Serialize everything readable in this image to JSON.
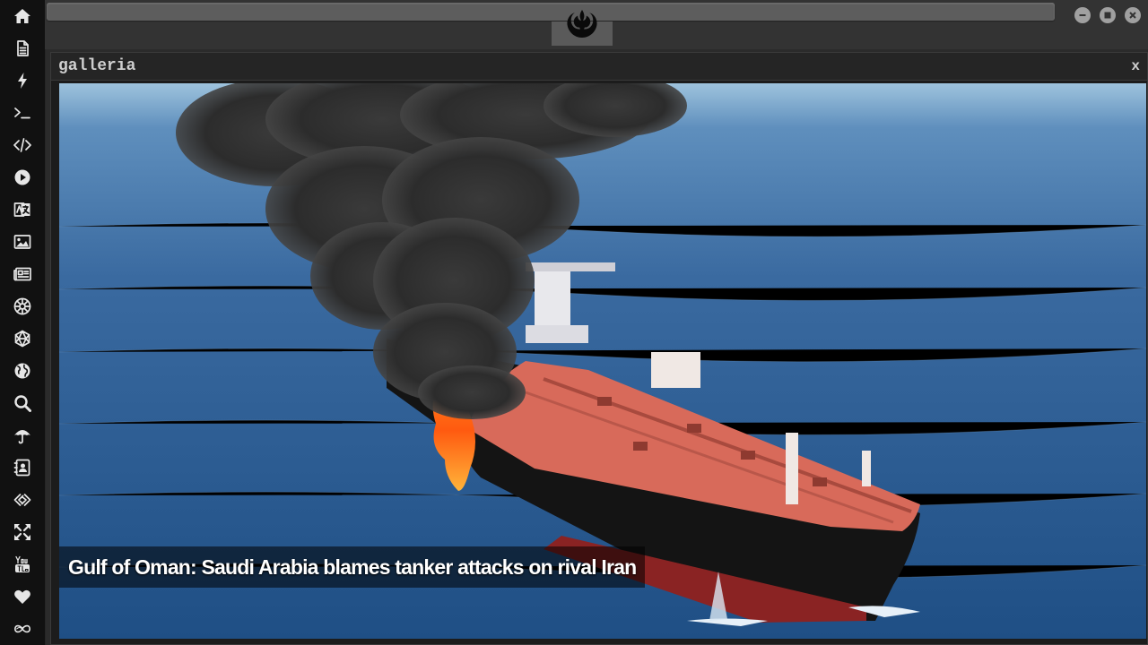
{
  "sidebar": {
    "items": [
      {
        "icon": "home-icon"
      },
      {
        "icon": "document-icon"
      },
      {
        "icon": "lightning-icon"
      },
      {
        "icon": "terminal-icon"
      },
      {
        "icon": "code-icon"
      },
      {
        "icon": "play-icon"
      },
      {
        "icon": "translate-icon"
      },
      {
        "icon": "image-icon"
      },
      {
        "icon": "newspaper-icon"
      },
      {
        "icon": "galactic-empire-icon"
      },
      {
        "icon": "hexagon-icon"
      },
      {
        "icon": "globe-icon"
      },
      {
        "icon": "search-icon"
      },
      {
        "icon": "umbrella-icon"
      },
      {
        "icon": "contacts-icon"
      },
      {
        "icon": "code-diamond-icon"
      },
      {
        "icon": "expand-icon"
      },
      {
        "icon": "youtube-icon"
      },
      {
        "icon": "heart-icon"
      },
      {
        "icon": "infinity-icon"
      }
    ]
  },
  "topbar": {
    "logo_icon": "rebel-alliance-icon",
    "window_controls": [
      "minimize-icon",
      "maximize-icon",
      "close-icon"
    ]
  },
  "panel": {
    "title": "galleria",
    "close_label": "x",
    "image": {
      "description_icon": "tanker-fire-photo",
      "caption": "Gulf of Oman: Saudi Arabia blames tanker attacks on rival Iran"
    }
  },
  "colors": {
    "sidebar_bg": "#111111",
    "topbar_bg": "#333333",
    "panel_bg": "#1c1c1c",
    "sea": "#2f5f93",
    "deck": "#d86a5a"
  }
}
